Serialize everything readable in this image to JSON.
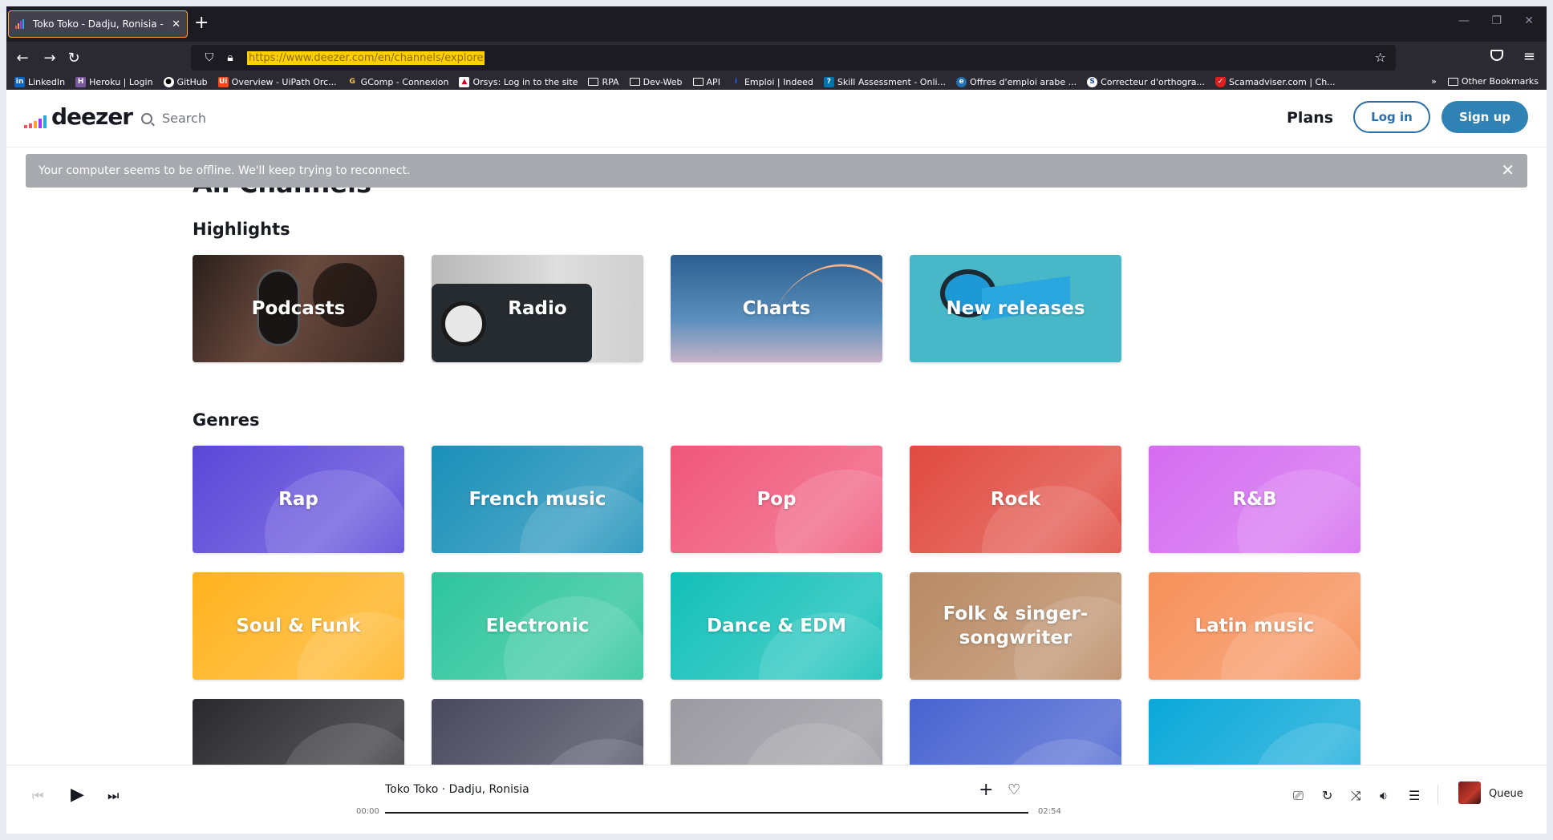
{
  "browser": {
    "tab_title": "Toko Toko - Dadju, Ronisia - Dee",
    "url": "https://www.deezer.com/en/channels/explore",
    "bookmarks": [
      {
        "label": "LinkedIn",
        "icon": "linkedin-icon"
      },
      {
        "label": "Heroku | Login",
        "icon": "heroku-icon"
      },
      {
        "label": "GitHub",
        "icon": "github-icon"
      },
      {
        "label": "Overview - UiPath Orc...",
        "icon": "uipath-icon"
      },
      {
        "label": "GComp - Connexion",
        "icon": "gcomp-icon"
      },
      {
        "label": "Orsys: Log in to the site",
        "icon": "orsys-icon"
      },
      {
        "label": "RPA",
        "icon": "folder-icon"
      },
      {
        "label": "Dev-Web",
        "icon": "folder-icon"
      },
      {
        "label": "API",
        "icon": "folder-icon"
      },
      {
        "label": "Emploi | Indeed",
        "icon": "indeed-icon"
      },
      {
        "label": "Skill Assessment - Onli...",
        "icon": "skill-icon"
      },
      {
        "label": "Offres d'emploi arabe ...",
        "icon": "offres-icon"
      },
      {
        "label": "Correcteur d'orthogra...",
        "icon": "correcteur-icon"
      },
      {
        "label": "Scamadviser.com | Ch...",
        "icon": "scamadviser-icon"
      }
    ],
    "other_bookmarks": "Other Bookmarks"
  },
  "header": {
    "logo": "deezer",
    "search_label": "Search",
    "plans": "Plans",
    "login": "Log in",
    "signup": "Sign up"
  },
  "offline_banner": {
    "text": "Your computer seems to be offline. We'll keep trying to reconnect."
  },
  "main": {
    "page_title": "All Channels",
    "highlights_title": "Highlights",
    "highlights": [
      {
        "label": "Podcasts",
        "color": "#5a3a30"
      },
      {
        "label": "Radio",
        "color": "#3a4048"
      },
      {
        "label": "Charts",
        "color": "#3f6fa3"
      },
      {
        "label": "New releases",
        "color": "#48b8c8"
      }
    ],
    "genres_title": "Genres",
    "genres": [
      {
        "label": "Rap",
        "color": "#5b47d8"
      },
      {
        "label": "French music",
        "color": "#1a8fb8"
      },
      {
        "label": "Pop",
        "color": "#f0577a"
      },
      {
        "label": "Rock",
        "color": "#e04a40"
      },
      {
        "label": "R&B",
        "color": "#d46cf0"
      },
      {
        "label": "Soul & Funk",
        "color": "#ffb21e"
      },
      {
        "label": "Electronic",
        "color": "#2dc59c"
      },
      {
        "label": "Dance & EDM",
        "color": "#12c0b8"
      },
      {
        "label": "Folk & singer-songwriter",
        "color": "#b98a64"
      },
      {
        "label": "Latin music",
        "color": "#f6905a"
      },
      {
        "label": "",
        "color": "#2a2a2e"
      },
      {
        "label": "",
        "color": "#4a4a5e"
      },
      {
        "label": "",
        "color": "#9a9aa0"
      },
      {
        "label": "",
        "color": "#4a64d0"
      },
      {
        "label": "",
        "color": "#0aa8d8"
      }
    ]
  },
  "player": {
    "track": "Toko Toko · Dadju, Ronisia",
    "time_current": "00:00",
    "time_total": "02:54",
    "queue": "Queue"
  }
}
